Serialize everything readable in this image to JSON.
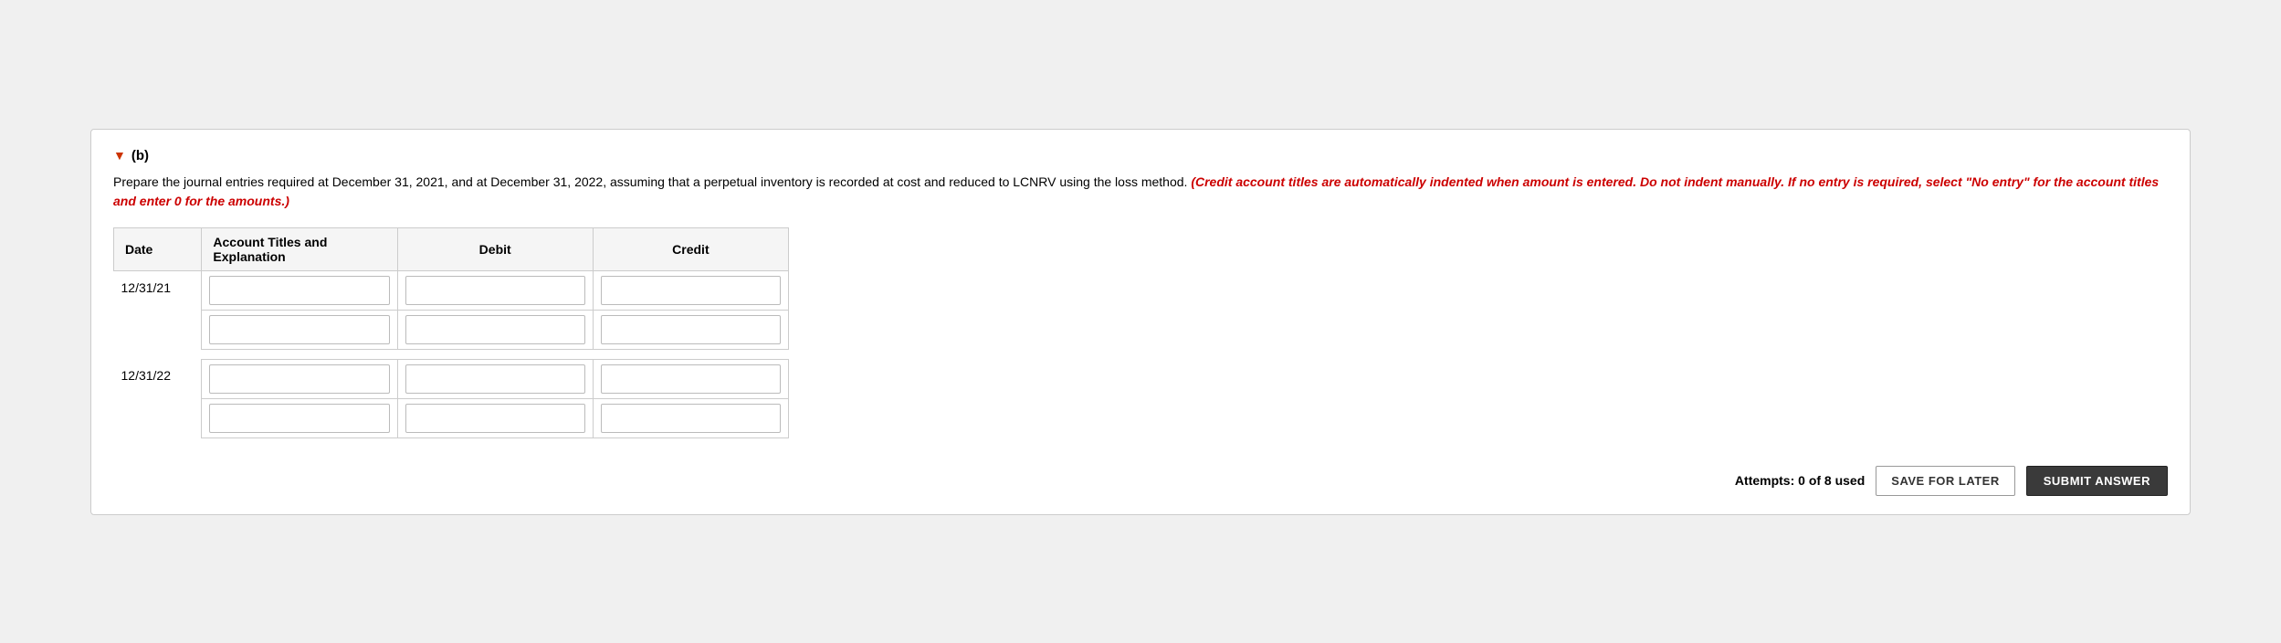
{
  "section": {
    "toggle_label": "▼",
    "part_label": "(b)",
    "instruction_plain": "Prepare the journal entries required at December 31, 2021, and at December 31, 2022, assuming that a perpetual inventory is recorded at cost and reduced to LCNRV using the loss method.",
    "instruction_red": "(Credit account titles are automatically indented when amount is entered. Do not indent manually. If no entry is required, select \"No entry\" for the account titles and enter 0 for the amounts.)"
  },
  "table": {
    "headers": {
      "date": "Date",
      "account": "Account Titles and Explanation",
      "debit": "Debit",
      "credit": "Credit"
    },
    "rows": [
      {
        "date": "12/31/21",
        "entries": [
          {
            "account": "",
            "debit": "",
            "credit": ""
          },
          {
            "account": "",
            "debit": "",
            "credit": ""
          }
        ]
      },
      {
        "date": "12/31/22",
        "entries": [
          {
            "account": "",
            "debit": "",
            "credit": ""
          },
          {
            "account": "",
            "debit": "",
            "credit": ""
          }
        ]
      }
    ]
  },
  "footer": {
    "attempts_label": "Attempts: 0 of 8 used",
    "save_label": "SAVE FOR LATER",
    "submit_label": "SUBMIT ANSWER"
  }
}
